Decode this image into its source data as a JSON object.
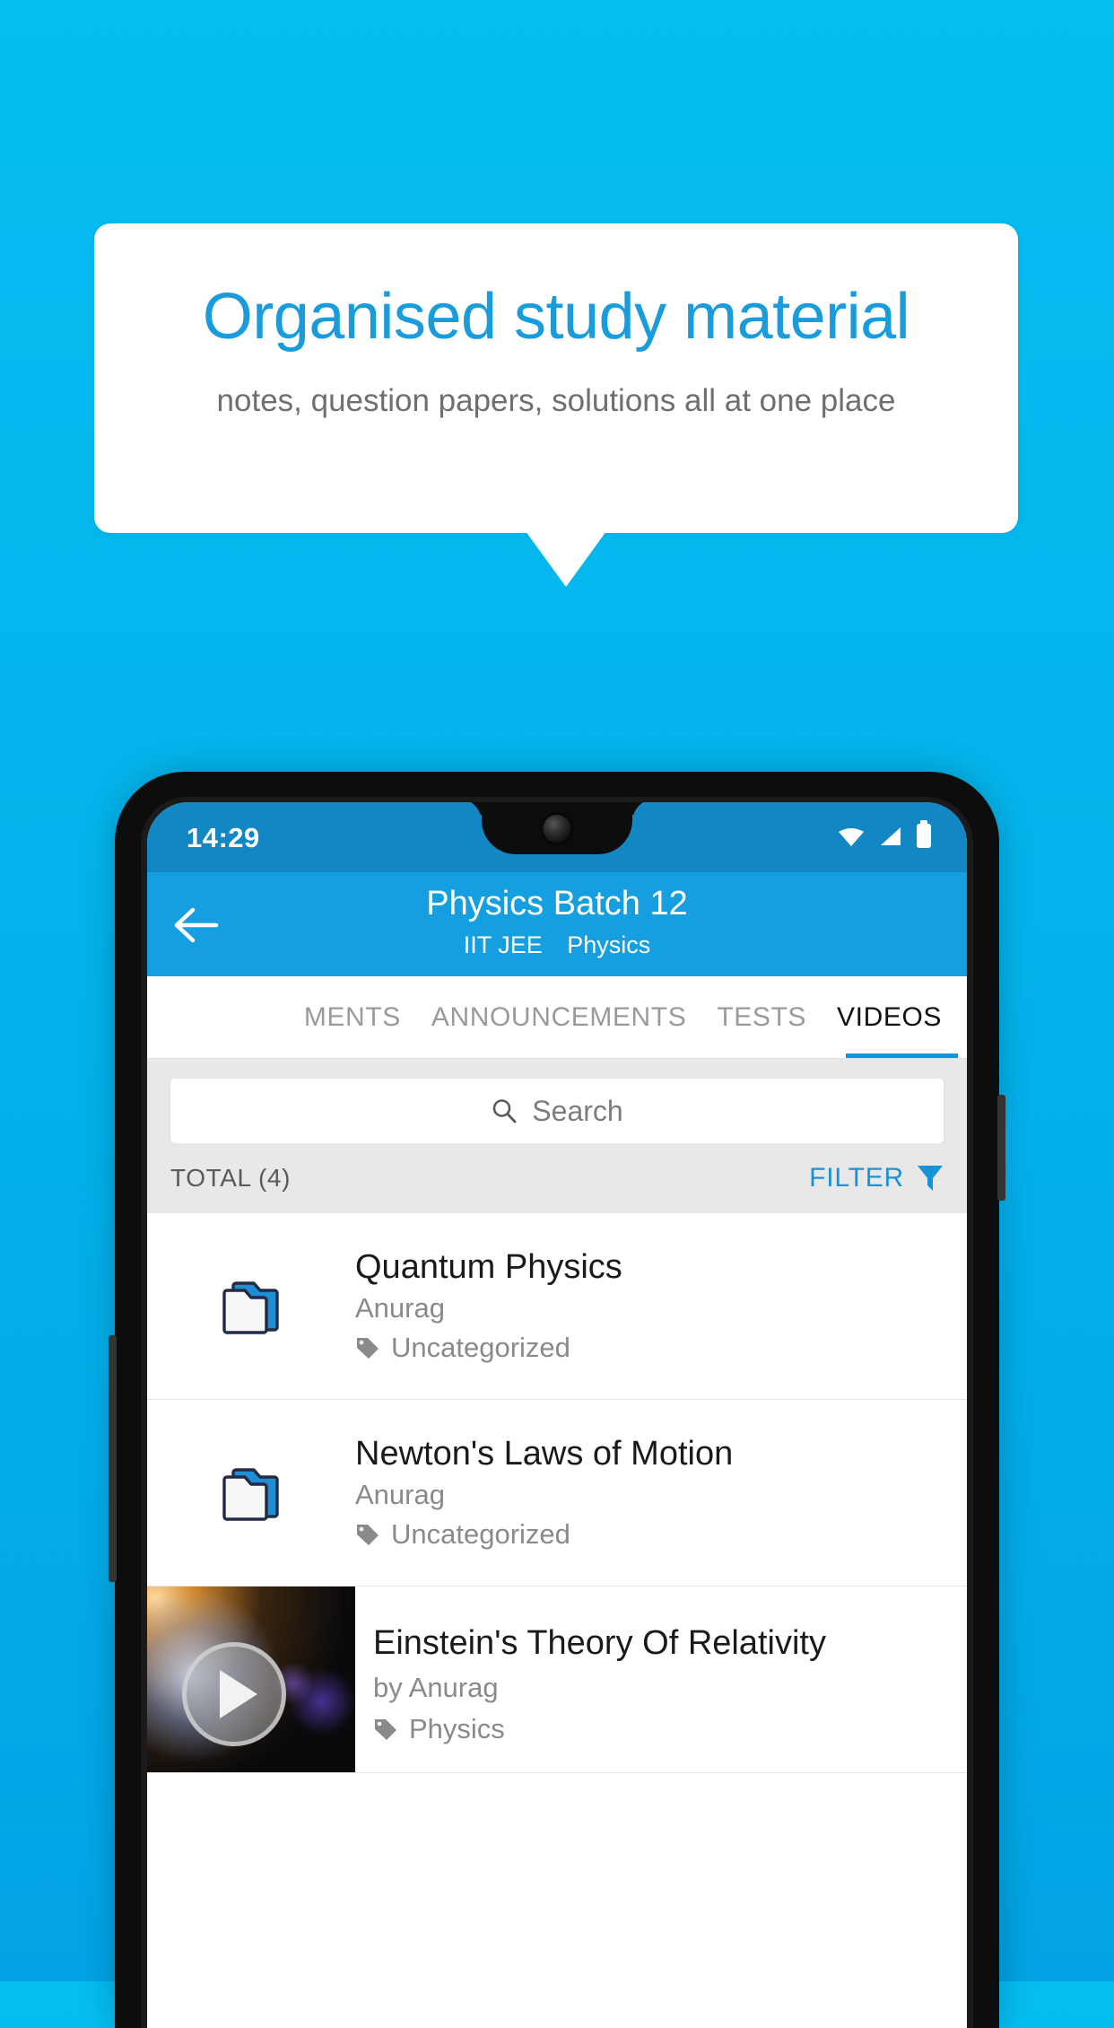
{
  "promo": {
    "headline": "Organised study material",
    "subhead": "notes, question papers, solutions all at one place",
    "accent_color": "#1A9BDC",
    "background_top": "#05BDF1",
    "background_bottom": "#02A3E4"
  },
  "phone": {
    "statusbar": {
      "time": "14:29",
      "icons": [
        "wifi-icon",
        "signal-icon",
        "battery-icon"
      ],
      "background": "#1386C4"
    },
    "appbar": {
      "back_icon": "back-arrow-icon",
      "title": "Physics Batch 12",
      "subtitle_exam": "IIT JEE",
      "subtitle_subject": "Physics",
      "background": "#159FE0"
    },
    "tabs": [
      {
        "label": "MENTS",
        "active": false
      },
      {
        "label": "ANNOUNCEMENTS",
        "active": false
      },
      {
        "label": "TESTS",
        "active": false
      },
      {
        "label": "VIDEOS",
        "active": true
      }
    ],
    "tab_indicator_color": "#1794D8",
    "search": {
      "icon": "search-icon",
      "placeholder": "Search",
      "value": ""
    },
    "toolbar": {
      "total_label": "TOTAL (4)",
      "filter_label": "FILTER",
      "filter_icon": "funnel-icon",
      "filter_color": "#1794D8"
    },
    "items": [
      {
        "icon": "folder-icon",
        "title": "Quantum Physics",
        "author": "Anurag",
        "tag_icon": "tag-icon",
        "tag": "Uncategorized",
        "type": "folder"
      },
      {
        "icon": "folder-icon",
        "title": "Newton's Laws of Motion",
        "author": "Anurag",
        "tag_icon": "tag-icon",
        "tag": "Uncategorized",
        "type": "folder"
      },
      {
        "icon": "video-thumbnail",
        "title": "Einstein's Theory Of Relativity",
        "author": "by Anurag",
        "tag_icon": "tag-icon",
        "tag": "Physics",
        "type": "video",
        "play_icon": "play-icon"
      }
    ]
  }
}
